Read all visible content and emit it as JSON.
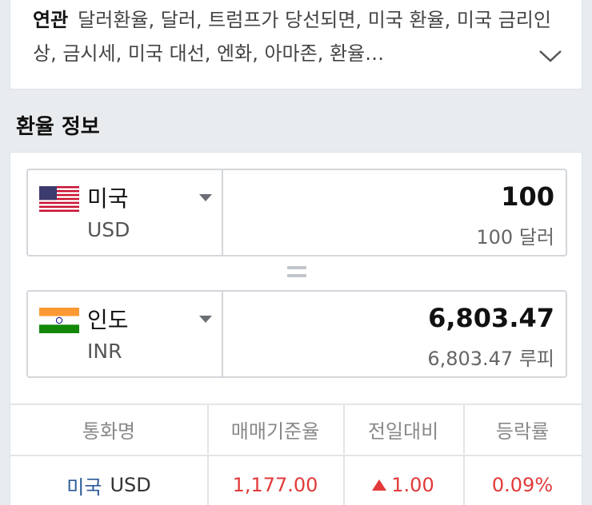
{
  "related": {
    "label": "연관",
    "keywords": "달러환율, 달러, 트럼프가 당선되면, 미국 환율, 미국 금리인상, 금시세, 미국 대선, 엔화, 아마존, 환율…"
  },
  "section_title": "환율 정보",
  "converter": {
    "from": {
      "name": "미국",
      "code": "USD",
      "amount": "100",
      "amount_words": "100 달러"
    },
    "to": {
      "name": "인도",
      "code": "INR",
      "amount": "6,803.47",
      "amount_words": "6,803.47 루피"
    }
  },
  "rate_table": {
    "headers": [
      "통화명",
      "매매기준율",
      "전일대비",
      "등락률"
    ],
    "row": {
      "country": "미국",
      "code": "USD",
      "base_rate": "1,177.00",
      "change": "1.00",
      "change_pct": "0.09%"
    }
  },
  "colors": {
    "up": "#e23a3a",
    "link": "#2a5a96"
  },
  "icons": [
    "chevron-down-icon",
    "us-flag-icon",
    "india-flag-icon",
    "dropdown-caret-icon",
    "equals-icon",
    "up-triangle-icon"
  ]
}
